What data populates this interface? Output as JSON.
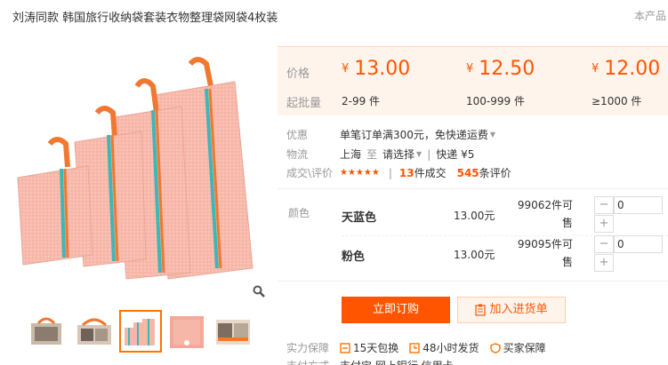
{
  "header": {
    "title": "刘涛同款 韩国旅行收纳袋套装衣物整理袋网袋4枚装",
    "cropped_link": "本产品"
  },
  "price_panel": {
    "price_label": "价格",
    "qty_label": "起批量",
    "currency": "¥",
    "tiers": [
      {
        "price": "13.00",
        "qty": "2-99 件"
      },
      {
        "price": "12.50",
        "qty": "100-999 件"
      },
      {
        "price": "12.00",
        "qty": "≥1000 件"
      }
    ]
  },
  "info": {
    "promo_label": "优惠",
    "promo_text": "单笔订单满300元，免快递运费",
    "logistics_label": "物流",
    "from_city": "上海",
    "to_word": "至",
    "select_text": "请选择",
    "express_text": "快递 ¥5",
    "deals_label": "成交\\评价",
    "deals_count": "13",
    "deals_suffix": "件成交",
    "review_count": "545",
    "review_suffix": "条评价",
    "rating_stars": 5
  },
  "sku": {
    "color_label": "颜色",
    "rows": [
      {
        "name": "天蓝色",
        "price": "13.00元",
        "stock": "99062件可售",
        "qty": "0"
      },
      {
        "name": "粉色",
        "price": "13.00元",
        "stock": "99095件可售",
        "qty": "0"
      }
    ]
  },
  "actions": {
    "order_label": "立即订购",
    "cart_label": "加入进货单"
  },
  "guarantee": {
    "label": "实力保障",
    "items": [
      "15天包换",
      "48小时发货",
      "买家保障"
    ]
  },
  "payment": {
    "label": "支付方式",
    "text": "支付宝  网上银行  信用卡"
  },
  "colors": {
    "accent": "#ff5500",
    "panel_bg": "#fff4ec"
  }
}
